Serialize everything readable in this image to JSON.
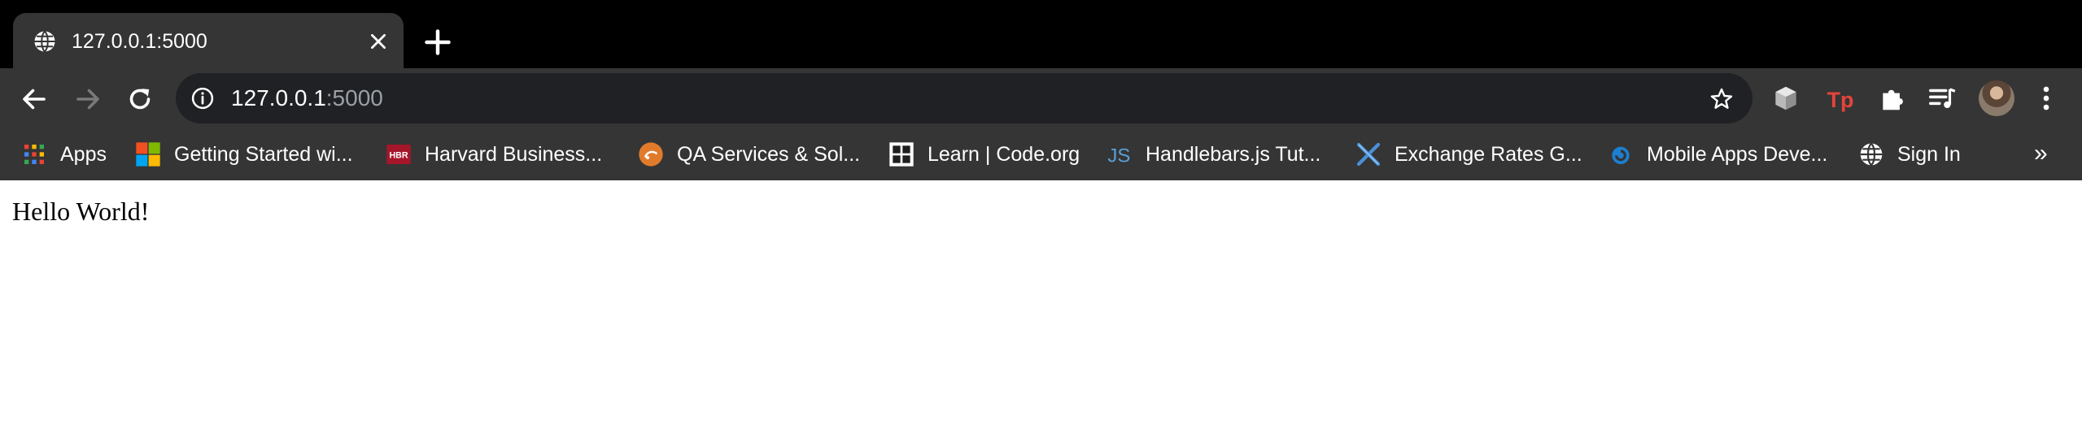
{
  "tab": {
    "title": "127.0.0.1:5000",
    "favicon": "globe-icon"
  },
  "omnibox": {
    "host": "127.0.0.1",
    "port": ":5000"
  },
  "bookmarks": [
    {
      "label": "Apps",
      "icon": "apps-grid-icon"
    },
    {
      "label": "Getting Started wi...",
      "icon": "microsoft-icon"
    },
    {
      "label": "Harvard Business...",
      "icon": "hbr-icon"
    },
    {
      "label": "QA Services & Sol...",
      "icon": "qa-services-icon"
    },
    {
      "label": "Learn | Code.org",
      "icon": "code-org-icon"
    },
    {
      "label": "Handlebars.js Tut...",
      "icon": "js-icon"
    },
    {
      "label": "Exchange Rates G...",
      "icon": "exchange-rates-icon"
    },
    {
      "label": "Mobile Apps Deve...",
      "icon": "mobile-apps-icon"
    },
    {
      "label": "Sign In",
      "icon": "globe-icon"
    }
  ],
  "bookmarks_overflow": "»",
  "page": {
    "text": "Hello World!"
  },
  "colors": {
    "tabstrip": "#000000",
    "toolbar": "#353535",
    "omnibox": "#202124",
    "text_light": "#ffffff",
    "url_muted": "#9aa0a6",
    "content_bg": "#ffffff"
  }
}
